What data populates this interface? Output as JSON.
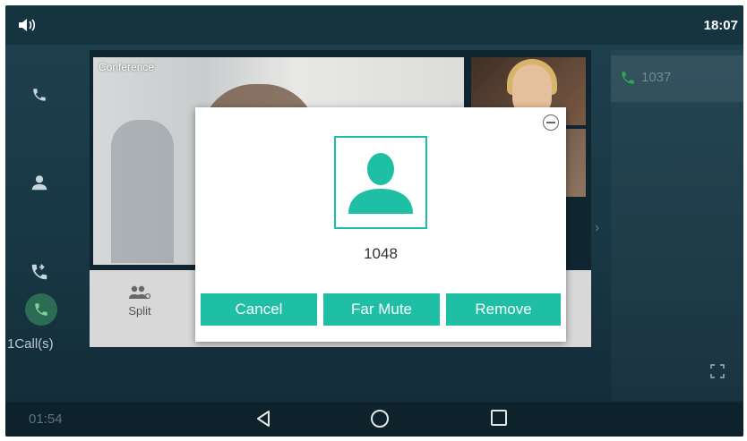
{
  "status_bar": {
    "time": "18:07",
    "speaker_icon": "speaker-icon"
  },
  "sidebar": {
    "items": [
      {
        "name": "phone-icon"
      },
      {
        "name": "contacts-icon"
      },
      {
        "name": "call-history-icon"
      }
    ],
    "calls_count": "1Call(s)"
  },
  "conference": {
    "label": "Conference",
    "split_label": "Split"
  },
  "right_panel": {
    "call_number": "1037"
  },
  "dialog": {
    "contact_number": "1048",
    "buttons": {
      "cancel": "Cancel",
      "far_mute": "Far Mute",
      "remove": "Remove"
    }
  },
  "nav_bar": {
    "timer": "01:54"
  },
  "colors": {
    "accent": "#1fbfa6",
    "call_green": "#2ea84f",
    "background": "#1f4150"
  }
}
